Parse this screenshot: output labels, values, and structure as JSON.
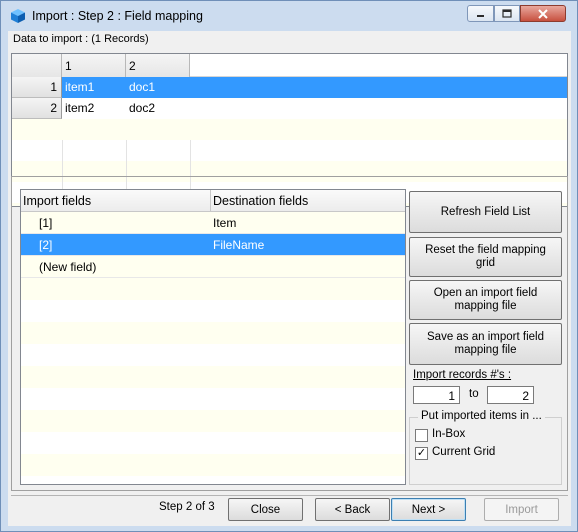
{
  "window": {
    "title": "Import : Step 2 : Field mapping",
    "icons": {
      "app": "cube-icon",
      "minimize": "minimize-icon",
      "maximize": "maximize-icon",
      "close": "close-icon"
    }
  },
  "data_label": "Data to import : (1 Records)",
  "preview_grid": {
    "columns": [
      "1",
      "2"
    ],
    "rows": [
      {
        "num": "1",
        "cells": [
          "item1",
          "doc1"
        ]
      },
      {
        "num": "2",
        "cells": [
          "item2",
          "doc2"
        ]
      }
    ]
  },
  "mapping_grid": {
    "columns": [
      "Import fields",
      "Destination fields"
    ],
    "rows": [
      {
        "import": "[1]",
        "dest": "Item"
      },
      {
        "import": "[2]",
        "dest": "FileName"
      },
      {
        "import": "(New field)",
        "dest": ""
      }
    ]
  },
  "side": {
    "refresh": "Refresh Field List",
    "reset": "Reset the field mapping grid",
    "open": "Open an import field mapping file",
    "save": "Save as an import field mapping file",
    "records_label": "Import records #'s :",
    "from": "1",
    "to_label": "to",
    "to": "2",
    "put_label": "Put imported items in ...",
    "inbox": "In-Box",
    "inbox_checked": false,
    "current_grid": "Current Grid",
    "current_grid_checked": true
  },
  "footer": {
    "step": "Step 2 of 3",
    "close": "Close",
    "back": "< Back",
    "next": "Next >",
    "import": "Import"
  },
  "colors": {
    "selection": "#3399ff",
    "stripe": "#fffff0",
    "frame": "#ccdcef"
  }
}
